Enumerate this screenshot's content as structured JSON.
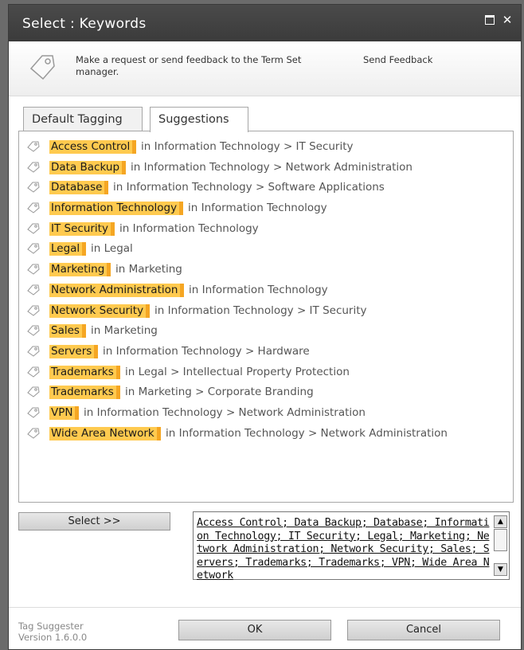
{
  "dialog": {
    "title": "Select : Keywords",
    "maximize_icon": "maximize-icon",
    "close_icon": "close-icon",
    "close_label": "✕"
  },
  "feedback": {
    "icon": "tag-icon",
    "message": "Make a request or send feedback to the Term Set manager.",
    "link": "Send Feedback"
  },
  "tabs": [
    {
      "label": "Default Tagging",
      "active": false
    },
    {
      "label": "Suggestions",
      "active": true
    }
  ],
  "suggestions": [
    {
      "term": "Access Control",
      "path": "in Information Technology > IT Security"
    },
    {
      "term": "Data Backup",
      "path": "in Information Technology > Network Administration"
    },
    {
      "term": "Database",
      "path": "in Information Technology > Software Applications"
    },
    {
      "term": "Information Technology",
      "path": "in Information Technology"
    },
    {
      "term": "IT Security",
      "path": "in Information Technology"
    },
    {
      "term": "Legal",
      "path": "in Legal"
    },
    {
      "term": "Marketing",
      "path": "in Marketing"
    },
    {
      "term": "Network Administration",
      "path": "in Information Technology"
    },
    {
      "term": "Network Security",
      "path": "in Information Technology > IT Security"
    },
    {
      "term": "Sales",
      "path": "in Marketing"
    },
    {
      "term": "Servers",
      "path": "in Information Technology > Hardware"
    },
    {
      "term": "Trademarks",
      "path": "in Legal > Intellectual Property Protection"
    },
    {
      "term": "Trademarks",
      "path": "in Marketing > Corporate Branding"
    },
    {
      "term": "VPN",
      "path": "in Information Technology > Network Administration"
    },
    {
      "term": "Wide Area Network",
      "path": "in Information Technology > Network Administration"
    }
  ],
  "select_button": "Select >>",
  "selected_terms": "Access Control; Data Backup; Database; Information Technology; IT Security; Legal; Marketing; Network Administration; Network Security; Sales; Servers; Trademarks; Trademarks; VPN; Wide Area Network",
  "footer": {
    "app_name": "Tag Suggester",
    "version": "Version 1.6.0.0",
    "ok": "OK",
    "cancel": "Cancel"
  },
  "colors": {
    "highlight": "#ffca4f",
    "highlight_edge": "#f5a623",
    "titlebar": "#3f3f3f"
  }
}
